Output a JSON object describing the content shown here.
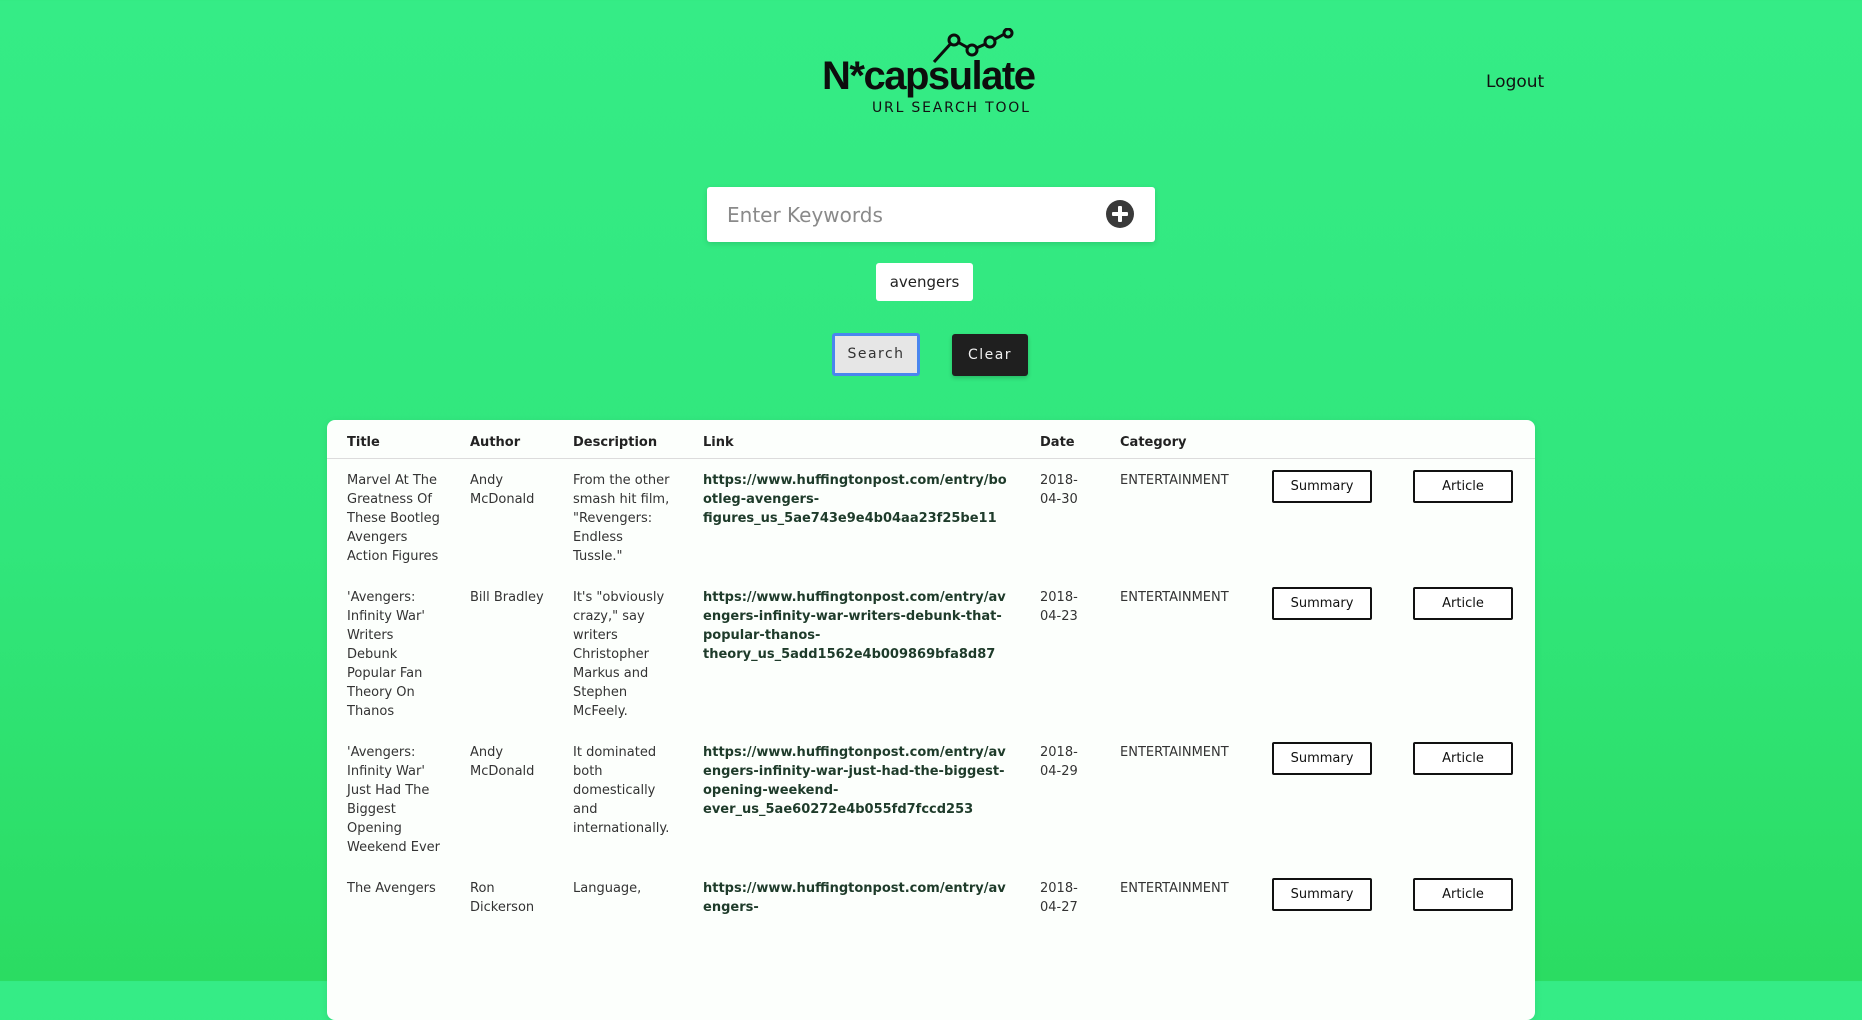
{
  "header": {
    "logo_text": "N*capsulate",
    "logo_subtitle": "URL SEARCH TOOL",
    "logout_label": "Logout"
  },
  "search": {
    "placeholder": "Enter Keywords",
    "value": "",
    "add_icon": "plus-circle-icon",
    "keywords": [
      "avengers"
    ],
    "search_label": "Search",
    "clear_label": "Clear"
  },
  "table": {
    "columns": [
      "Title",
      "Author",
      "Description",
      "Link",
      "Date",
      "Category",
      "",
      ""
    ],
    "rows": [
      {
        "title": "Marvel At The Greatness Of These Bootleg Avengers Action Figures",
        "author": "Andy McDonald",
        "description": "From the other smash hit film, \"Revengers: Endless Tussle.\"",
        "link": "https://www.huffingtonpost.com/entry/bootleg-avengers-figures_us_5ae743e9e4b04aa23f25be11",
        "date": "2018-04-30",
        "category": "ENTERTAINMENT",
        "summary_label": "Summary",
        "article_label": "Article"
      },
      {
        "title": "'Avengers: Infinity War' Writers Debunk Popular Fan Theory On Thanos",
        "author": "Bill Bradley",
        "description": "It's \"obviously crazy,\" say writers Christopher Markus and Stephen McFeely.",
        "link": "https://www.huffingtonpost.com/entry/avengers-infinity-war-writers-debunk-that-popular-thanos-theory_us_5add1562e4b009869bfa8d87",
        "date": "2018-04-23",
        "category": "ENTERTAINMENT",
        "summary_label": "Summary",
        "article_label": "Article"
      },
      {
        "title": "'Avengers: Infinity War' Just Had The Biggest Opening Weekend Ever",
        "author": "Andy McDonald",
        "description": "It dominated both domestically and internationally.",
        "link": "https://www.huffingtonpost.com/entry/avengers-infinity-war-just-had-the-biggest-opening-weekend-ever_us_5ae60272e4b055fd7fccd253",
        "date": "2018-04-29",
        "category": "ENTERTAINMENT",
        "summary_label": "Summary",
        "article_label": "Article"
      },
      {
        "title": "The Avengers",
        "author": "Ron Dickerson",
        "description": "Language,",
        "link": "https://www.huffingtonpost.com/entry/avengers-",
        "date": "2018-04-27",
        "category": "ENTERTAINMENT",
        "summary_label": "Summary",
        "article_label": "Article"
      }
    ]
  }
}
